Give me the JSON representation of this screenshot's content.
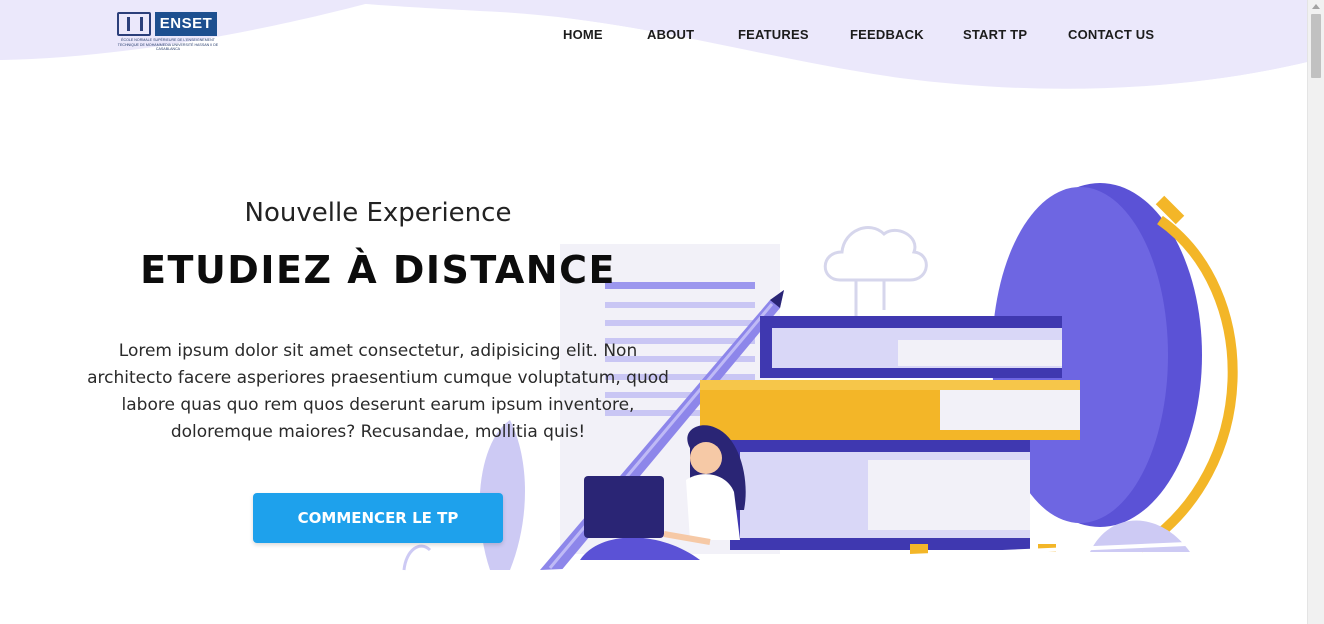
{
  "brand": {
    "logo_text": "ENSET",
    "logo_subtext": "ÉCOLE NORMALE SUPÉRIEURE DE L'ENSEIGNEMENT TECHNIQUE DE MOHAMMEDIA UNIVERSITÉ HASSAN II DE CASABLANCA"
  },
  "nav": {
    "items": [
      {
        "label": "HOME"
      },
      {
        "label": "ABOUT"
      },
      {
        "label": "FEATURES"
      },
      {
        "label": "FEEDBACK"
      },
      {
        "label": "START TP"
      },
      {
        "label": "CONTACT US"
      }
    ]
  },
  "hero": {
    "subtitle": "Nouvelle Experience",
    "headline": "ETUDIEZ À DISTANCE",
    "lead": "Lorem ipsum dolor sit amet consectetur, adipisicing elit. Non architecto facere asperiores praesentium cumque voluptatum, quod labore quas quo rem quos deserunt earum ipsum inventore, doloremque maiores? Recusandae, mollitia quis!",
    "cta_label": "COMMENCER LE TP"
  },
  "colors": {
    "accent": "#1ea1ec",
    "wave": "#ebe8fb",
    "purple": "#5b52d6",
    "yellow": "#f3b628",
    "navy": "#2a2575"
  }
}
